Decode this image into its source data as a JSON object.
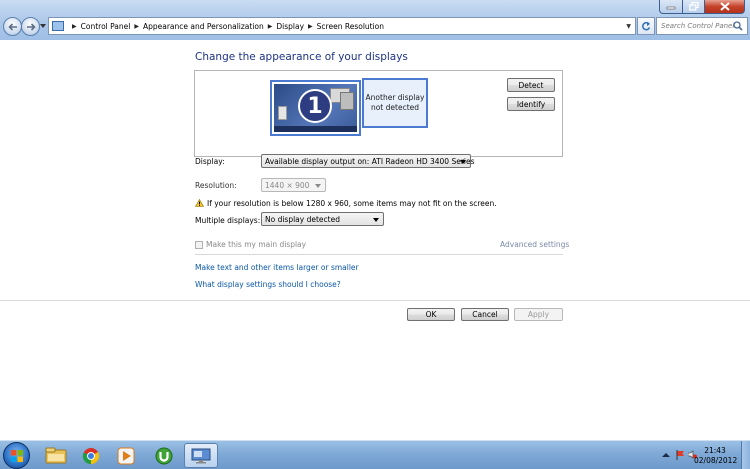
{
  "window": {
    "minimize_icon": "minimize-icon",
    "maximize_icon": "restore-icon",
    "close_icon": "close-icon",
    "close_color": "#c5422a"
  },
  "address_bar": {
    "breadcrumbs": [
      "Control Panel",
      "Appearance and Personalization",
      "Display",
      "Screen Resolution"
    ],
    "search_placeholder": "Search Control Panel"
  },
  "main": {
    "title": "Change the appearance of your displays",
    "monitors": [
      {
        "number": "1"
      },
      {
        "label_line1": "Another display",
        "label_line2": "not detected"
      }
    ],
    "detect_label": "Detect",
    "identify_label": "Identify",
    "display_label": "Display:",
    "display_value": "Available display output on: ATI Radeon HD 3400 Series",
    "resolution_label": "Resolution:",
    "resolution_value": "1440 × 900",
    "warning_text": "If your resolution is below 1280 x 960, some items may not fit on the screen.",
    "multiple_label": "Multiple displays:",
    "multiple_value": "No display detected",
    "main_display_label": "Make this my main display",
    "advanced_settings": "Advanced settings",
    "link_larger": "Make text and other items larger or smaller",
    "link_which": "What display settings should I choose?",
    "ok_label": "OK",
    "cancel_label": "Cancel",
    "apply_label": "Apply",
    "link_color": "#0b58a8",
    "title_color": "#1e3287"
  },
  "taskbar": {
    "items": [
      "windows-explorer-icon",
      "chrome-icon",
      "media-player-icon",
      "utorrent-icon",
      "screen-resolution-icon"
    ],
    "time": "21:43",
    "date": "02/08/2012",
    "tray_icons": [
      "show-hidden-icons-icon",
      "network-icon",
      "volume-mute-icon",
      "flag-icon"
    ]
  }
}
